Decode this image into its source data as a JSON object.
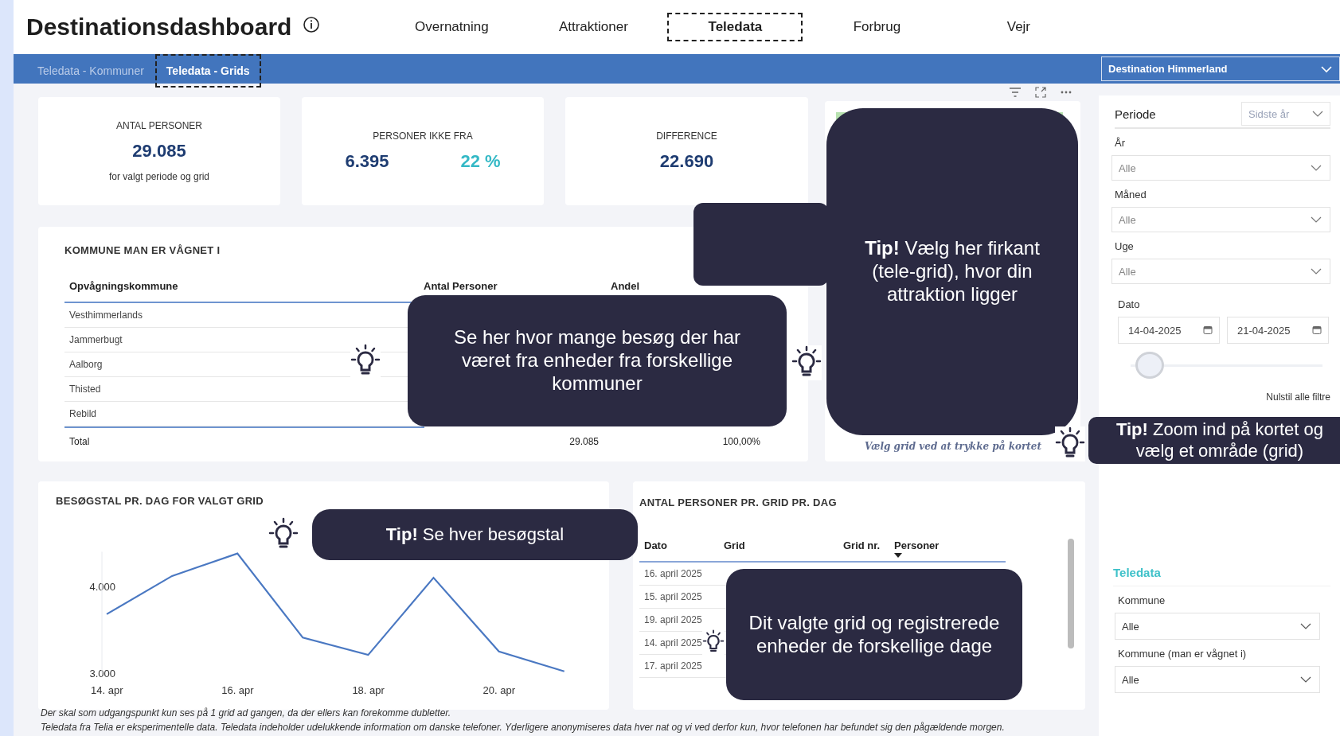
{
  "header": {
    "title": "Destinationsdashboard",
    "nav": [
      {
        "label": "Overnatning",
        "selected": false
      },
      {
        "label": "Attraktioner",
        "selected": false
      },
      {
        "label": "Teledata",
        "selected": true
      },
      {
        "label": "Forbrug",
        "selected": false
      },
      {
        "label": "Vejr",
        "selected": false
      }
    ]
  },
  "subtabs": [
    {
      "label": "Teledata - Kommuner",
      "selected": false
    },
    {
      "label": "Teledata - Grids",
      "selected": true
    }
  ],
  "destination": {
    "value": "Destination Himmerland"
  },
  "kpis": [
    {
      "title": "ANTAL PERSONER",
      "value": "29.085",
      "note": "for valgt periode og grid"
    },
    {
      "title": "PERSONER IKKE FRA",
      "value": "6.395",
      "share": "22 %"
    },
    {
      "title": "DIFFERENCE",
      "value": "22.690"
    }
  ],
  "kommune_table": {
    "title": "KOMMUNE MAN ER VÅGNET I",
    "columns": [
      "Opvågningskommune",
      "Antal Personer",
      "Andel"
    ],
    "rows": [
      "Vesthimmerlands",
      "Jammerbugt",
      "Aalborg",
      "Thisted",
      "Rebild"
    ],
    "total": [
      "Total",
      "29.085",
      "100,00%"
    ]
  },
  "map": {
    "caption": "Vælg grid ved at trykke på kortet"
  },
  "chart": {
    "title": "BESØGSTAL PR. DAG FOR VALGT GRID",
    "chart_data": {
      "type": "line",
      "categories": [
        "14. apr",
        null,
        "16. apr",
        null,
        "18. apr",
        null,
        "20. apr",
        null
      ],
      "series": [
        {
          "color": "#4a78c2",
          "values": [
            3680,
            4120,
            4380,
            3410,
            3210,
            4100,
            3250,
            3020
          ]
        }
      ],
      "ylim": [
        3000,
        4400
      ],
      "yticks": [
        {
          "value": 3000,
          "label": "3.000"
        },
        {
          "value": 4000,
          "label": "4.000"
        }
      ]
    }
  },
  "grid_table": {
    "title": "ANTAL PERSONER PR. GRID PR. DAG",
    "columns": [
      "Dato",
      "Grid",
      "Grid nr.",
      "Personer"
    ],
    "rows": [
      "16. april 2025",
      "15. april 2025",
      "19. april 2025",
      "14. april 2025",
      "17. april 2025"
    ]
  },
  "filters": {
    "periode": {
      "label": "Periode",
      "value": "Sidste år"
    },
    "dropdowns": [
      {
        "label": "År",
        "value": "Alle"
      },
      {
        "label": "Måned",
        "value": "Alle"
      },
      {
        "label": "Uge",
        "value": "Alle"
      }
    ],
    "dato": {
      "label": "Dato",
      "from": "14-04-2025",
      "to": "21-04-2025",
      "level": 0.1
    },
    "reset": "Nulstil alle filtre",
    "teledata": {
      "heading": "Teledata",
      "dropdowns": [
        {
          "label": "Kommune",
          "value": "Alle"
        },
        {
          "label": "Kommune (man er vågnet i)",
          "value": "Alle"
        }
      ]
    }
  },
  "tips": [
    {
      "text": "**Tip!** Vælg her firkant (tele-grid), hvor din attraktion ligger"
    },
    {
      "text": "Se her hvor mange besøg der har været fra enheder fra forskellige kommuner"
    },
    {
      "text": "**Tip!** Zoom ind på kortet og vælg et område (grid)"
    },
    {
      "text": "**Tip!** Se hver besøgstal"
    },
    {
      "text": "Dit valgte grid og registrerede enheder de forskellige dage"
    }
  ],
  "footnotes": [
    "Der skal som udgangspunkt kun ses på 1 grid ad gangen, da der ellers kan forekomme dubletter.",
    "Teledata fra Telia er eksperimentelle data. Teledata indeholder udelukkende information om danske telefoner. Yderligere anonymiseres data hver nat og vi ved derfor kun, hvor telefonen har befundet sig den pågældende morgen."
  ]
}
